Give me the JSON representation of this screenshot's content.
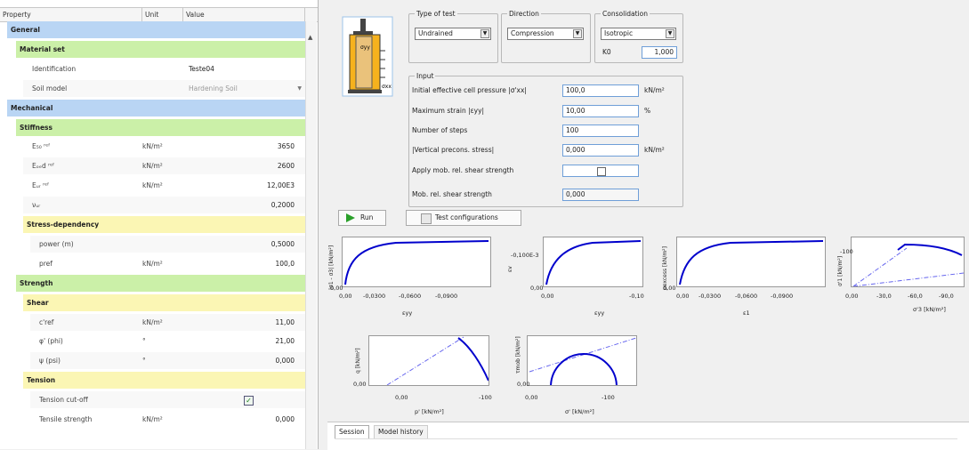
{
  "grid": {
    "headers": {
      "property": "Property",
      "unit": "Unit",
      "value": "Value"
    },
    "rows": [
      {
        "label": "General",
        "unit": "",
        "value": "",
        "style": "blue",
        "indent": 0
      },
      {
        "label": "Material set",
        "unit": "",
        "value": "",
        "style": "green",
        "indent": 1
      },
      {
        "label": "Identification",
        "unit": "",
        "value": "Teste04",
        "style": "plain",
        "indent": 2
      },
      {
        "label": "Soil model",
        "unit": "",
        "value": "Hardening Soil",
        "style": "plain",
        "indent": 2,
        "dropdown": true
      },
      {
        "label": "Mechanical",
        "unit": "",
        "value": "",
        "style": "blue",
        "indent": 0
      },
      {
        "label": "Stiffness",
        "unit": "",
        "value": "",
        "style": "green",
        "indent": 1
      },
      {
        "label": "E₅₀ ʳᵉᶠ",
        "unit": "kN/m²",
        "value": "3650",
        "style": "plain",
        "indent": 2
      },
      {
        "label": "Eₒₑd ʳᵉᶠ",
        "unit": "kN/m²",
        "value": "2600",
        "style": "plain",
        "indent": 2
      },
      {
        "label": "Eᵤᵣ ʳᵉᶠ",
        "unit": "kN/m²",
        "value": "12,00E3",
        "style": "plain",
        "indent": 2
      },
      {
        "label": "νᵤᵣ",
        "unit": "",
        "value": "0,2000",
        "style": "plain",
        "indent": 2
      },
      {
        "label": "Stress-dependency",
        "unit": "",
        "value": "",
        "style": "yellow",
        "indent": 2
      },
      {
        "label": "power (m)",
        "unit": "",
        "value": "0,5000",
        "style": "plain",
        "indent": 3
      },
      {
        "label": "pref",
        "unit": "kN/m²",
        "value": "100,0",
        "style": "plain",
        "indent": 3
      },
      {
        "label": "Strength",
        "unit": "",
        "value": "",
        "style": "green",
        "indent": 1
      },
      {
        "label": "Shear",
        "unit": "",
        "value": "",
        "style": "yellow",
        "indent": 2
      },
      {
        "label": "c'ref",
        "unit": "kN/m²",
        "value": "11,00",
        "style": "plain",
        "indent": 3
      },
      {
        "label": "φ' (phi)",
        "unit": "°",
        "value": "21,00",
        "style": "plain",
        "indent": 3
      },
      {
        "label": "ψ (psi)",
        "unit": "°",
        "value": "0,000",
        "style": "plain",
        "indent": 3
      },
      {
        "label": "Tension",
        "unit": "",
        "value": "",
        "style": "yellow",
        "indent": 2
      },
      {
        "label": "Tension cut-off",
        "unit": "",
        "value": "",
        "style": "plain",
        "indent": 3,
        "checkbox": true
      },
      {
        "label": "Tensile strength",
        "unit": "kN/m²",
        "value": "0,000",
        "style": "plain",
        "indent": 3
      }
    ]
  },
  "test": {
    "type_legend": "Type of test",
    "type_value": "Undrained",
    "direction_legend": "Direction",
    "direction_value": "Compression",
    "consolidation_legend": "Consolidation",
    "consolidation_value": "Isotropic",
    "k0_label": "K0",
    "k0_value": "1,000"
  },
  "input": {
    "legend": "Input",
    "cell_pressure_label": "Initial effective cell pressure |σ'xx|",
    "cell_pressure_value": "100,0",
    "cell_pressure_unit": "kN/m²",
    "max_strain_label": "Maximum strain |εyy|",
    "max_strain_value": "10,00",
    "max_strain_unit": "%",
    "steps_label": "Number of steps",
    "steps_value": "100",
    "precons_label": "|Vertical precons. stress|",
    "precons_value": "0,000",
    "precons_unit": "kN/m²",
    "apply_mob_label": "Apply mob. rel. shear strength",
    "mob_label": "Mob. rel. shear strength",
    "mob_value": "0,000"
  },
  "actions": {
    "run_label": "Run",
    "configs_label": "Test configurations"
  },
  "plots": {
    "p1": {
      "ylabel": "|σ1 - σ3| [kN/m²]",
      "xlabel": "εyy",
      "x_ticks": [
        "0,00",
        "-0,0300",
        "-0,0600",
        "-0,0900"
      ],
      "y_ticks": [
        "0,00"
      ]
    },
    "p2": {
      "ylabel": "εv",
      "xlabel": "εyy",
      "x_ticks": [
        "0,00",
        "-0,10"
      ],
      "y_ticks": [
        "-0,100E-3",
        "0,00"
      ]
    },
    "p3": {
      "ylabel": "pexcess [kN/m²]",
      "xlabel": "ε1",
      "x_ticks": [
        "0,00",
        "-0,0300",
        "-0,0600",
        "-0,0900"
      ],
      "y_ticks": [
        "0,00"
      ]
    },
    "p4": {
      "ylabel": "σ'1 [kN/m²]",
      "xlabel": "σ'3 [kN/m²]",
      "x_ticks": [
        "0,00",
        "-30,0",
        "-60,0",
        "-90,0"
      ],
      "y_ticks": [
        "-100"
      ]
    },
    "p5": {
      "ylabel": "q [kN/m²]",
      "xlabel": "p' [kN/m²]",
      "x_ticks": [
        "0,00",
        "-100"
      ],
      "y_ticks": [
        "0,00"
      ]
    },
    "p6": {
      "ylabel": "τmob [kN/m²]",
      "xlabel": "σ' [kN/m²]",
      "x_ticks": [
        "0,00",
        "-100"
      ],
      "y_ticks": [
        "0,00"
      ]
    }
  },
  "tabs": {
    "session": "Session",
    "model_history": "Model history"
  },
  "colors": {
    "accent": "#0000cc",
    "blue_row": "#b9d5f4",
    "green_row": "#cbf0a8",
    "yellow_row": "#fbf6b4",
    "run_icon": "#2aa02a"
  }
}
